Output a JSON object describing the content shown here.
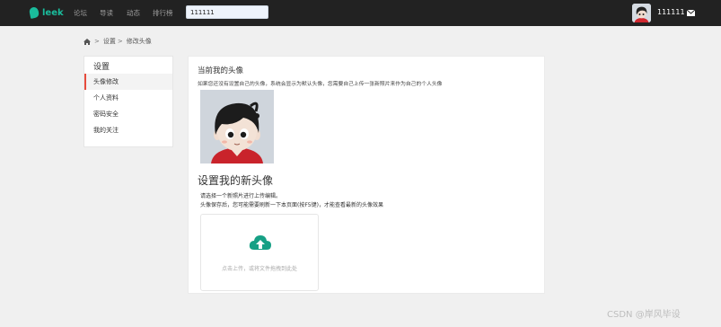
{
  "navbar": {
    "logo_text": "leek",
    "links": [
      "论坛",
      "导读",
      "动态",
      "排行榜"
    ],
    "search_value": "111111",
    "username": "111111"
  },
  "breadcrumb": {
    "items": [
      "设置",
      "修改头像"
    ],
    "separator": ">"
  },
  "sidebar": {
    "title": "设置",
    "items": [
      {
        "label": "头像修改",
        "active": true
      },
      {
        "label": "个人资料",
        "active": false
      },
      {
        "label": "密码安全",
        "active": false
      },
      {
        "label": "我的关注",
        "active": false
      }
    ]
  },
  "main": {
    "current_title": "当前我的头像",
    "current_desc": "如果您还没有设置自己的头像，系统会显示为默认头像，您需要自己上传一张新照片来作为自己的个人头像",
    "new_title": "设置我的新头像",
    "hint_line1": "请选择一个新照片进行上传编辑。",
    "hint_line2": "头像保存后，您可能需要刷新一下本页面(按F5键)，才能查看最新的头像效果",
    "upload_text": "点击上传，或将文件拖拽到此处"
  },
  "watermark": "CSDN @岸风毕设",
  "colors": {
    "navbar_bg": "#222222",
    "accent": "#1abc9c",
    "active_marker": "#e74c3c",
    "upload_icon": "#16a085"
  },
  "icons": [
    "leek-logo-icon",
    "home-icon",
    "mail-icon",
    "cloud-upload-icon",
    "cartoon-avatar"
  ]
}
